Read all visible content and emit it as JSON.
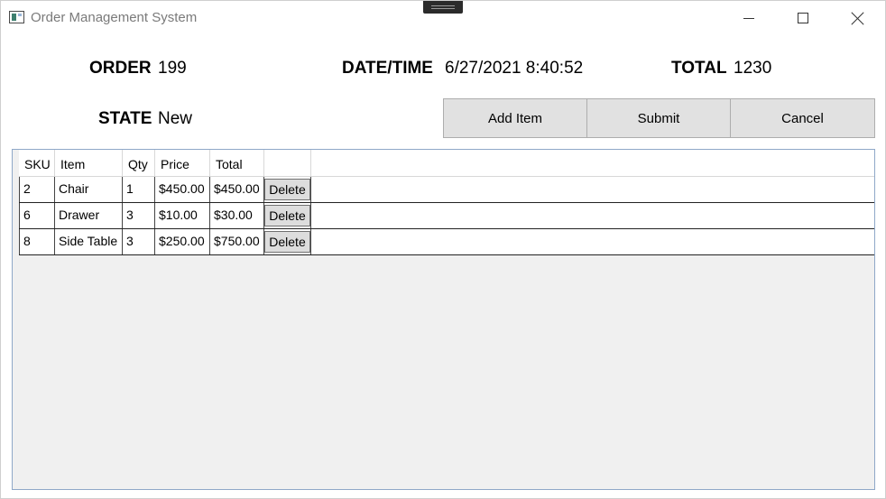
{
  "window": {
    "title": "Order Management System"
  },
  "order": {
    "order_label": "ORDER",
    "order_value": "199",
    "datetime_label": "DATE/TIME",
    "datetime_value": "6/27/2021 8:40:52",
    "total_label": "TOTAL",
    "total_value": "1230",
    "state_label": "STATE",
    "state_value": "New"
  },
  "actions": {
    "add_item": "Add Item",
    "submit": "Submit",
    "cancel": "Cancel"
  },
  "grid": {
    "columns": [
      "SKU",
      "Item",
      "Qty",
      "Price",
      "Total",
      ""
    ],
    "rows": [
      {
        "sku": "2",
        "item": "Chair",
        "qty": "1",
        "price": "$450.00",
        "total": "$450.00",
        "action": "Delete"
      },
      {
        "sku": "6",
        "item": "Drawer",
        "qty": "3",
        "price": "$10.00",
        "total": "$30.00",
        "action": "Delete"
      },
      {
        "sku": "8",
        "item": "Side Table",
        "qty": "3",
        "price": "$250.00",
        "total": "$750.00",
        "action": "Delete"
      }
    ]
  },
  "icons": {
    "app": "app-icon",
    "minimize": "minimize-icon",
    "maximize": "maximize-icon",
    "close": "close-icon"
  }
}
